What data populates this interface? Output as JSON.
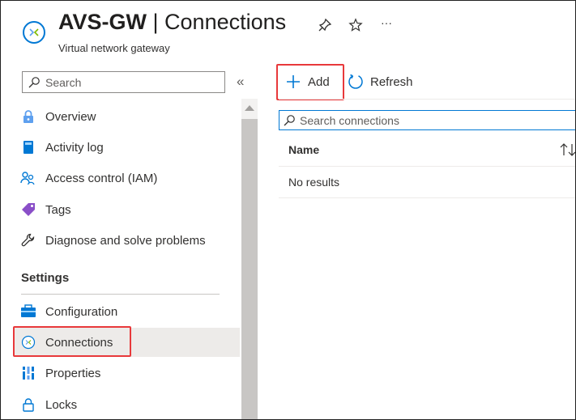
{
  "header": {
    "resource_name": "AVS-GW",
    "separator": "|",
    "blade_title": "Connections",
    "subtitle": "Virtual network gateway",
    "resource_icon": "virtual-network-gateway-icon",
    "pin_icon": "pin-icon",
    "favorite_icon": "star-icon",
    "more_label": "···"
  },
  "nav": {
    "search_placeholder": "Search",
    "collapse_label": "«",
    "items": [
      {
        "label": "Overview",
        "icon": "overview-icon"
      },
      {
        "label": "Activity log",
        "icon": "activity-log-icon"
      },
      {
        "label": "Access control (IAM)",
        "icon": "access-control-icon"
      },
      {
        "label": "Tags",
        "icon": "tag-icon"
      },
      {
        "label": "Diagnose and solve problems",
        "icon": "wrench-icon"
      }
    ],
    "section": "Settings",
    "settings_items": [
      {
        "label": "Configuration",
        "icon": "configuration-icon"
      },
      {
        "label": "Connections",
        "icon": "connections-icon",
        "selected": true
      },
      {
        "label": "Properties",
        "icon": "properties-icon"
      },
      {
        "label": "Locks",
        "icon": "lock-icon"
      }
    ]
  },
  "toolbar": {
    "add_label": "Add",
    "refresh_label": "Refresh"
  },
  "content": {
    "search_placeholder": "Search connections",
    "columns": [
      "Name"
    ],
    "empty_text": "No results"
  },
  "colors": {
    "accent": "#0078d4",
    "highlight": "#e8393b",
    "selected_bg": "#edebe9"
  }
}
